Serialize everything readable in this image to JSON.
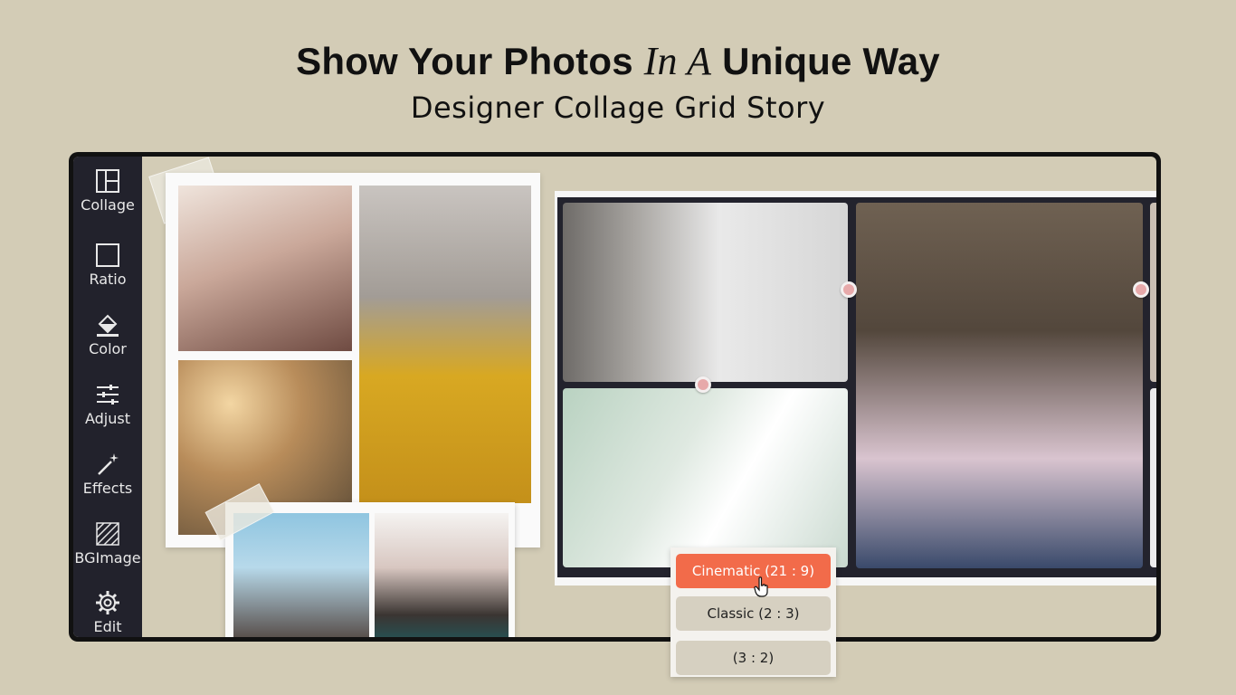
{
  "header": {
    "title_part1": "Show Your Photos ",
    "title_italic": "In A",
    "title_part2": " Unique Way",
    "subtitle": "Designer Collage Grid Story"
  },
  "sidebar": {
    "items": [
      {
        "label": "Collage",
        "icon": "collage-grid-icon"
      },
      {
        "label": "Ratio",
        "icon": "square-ratio-icon"
      },
      {
        "label": "Color",
        "icon": "paint-bucket-icon"
      },
      {
        "label": "Adjust",
        "icon": "sliders-icon"
      },
      {
        "label": "Effects",
        "icon": "magic-wand-icon"
      },
      {
        "label": "BGImage",
        "icon": "hatched-pattern-icon"
      },
      {
        "label": "Edit",
        "icon": "gear-icon"
      }
    ]
  },
  "ratio_menu": {
    "options": [
      {
        "label": "Cinematic (21 : 9)",
        "selected": true
      },
      {
        "label": "Classic (2 : 3)",
        "selected": false
      },
      {
        "label": "(3 : 2)",
        "selected": false
      }
    ]
  },
  "colors": {
    "background": "#d3ccb6",
    "sidebar": "#22222c",
    "accent": "#f26b4a",
    "handle": "#e7a9aa"
  }
}
